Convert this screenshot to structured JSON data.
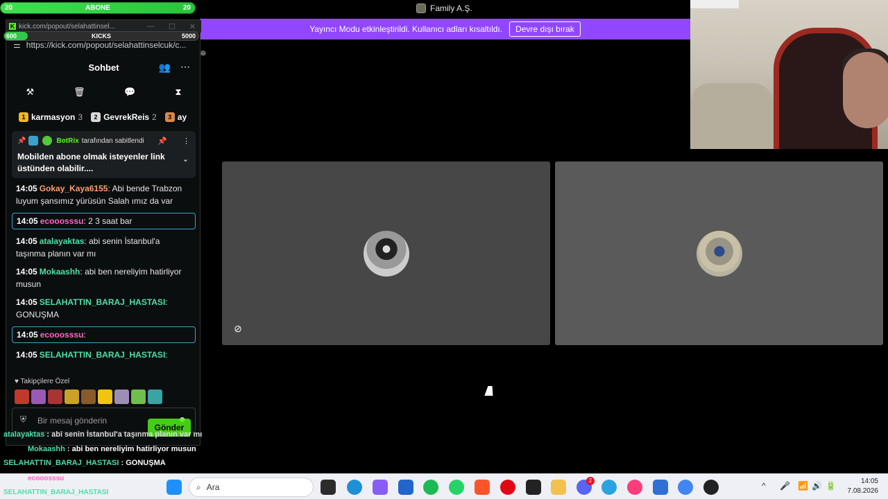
{
  "overlay": {
    "goal": {
      "left": "20",
      "label": "ABONE",
      "right": "20"
    },
    "kicks": {
      "current": "600",
      "label": "KICKS",
      "goal": "5000",
      "progress": 0.12
    }
  },
  "meeting": {
    "title": "Family A.Ş.",
    "banner_text": "Yayıncı Modu etkinleştirildi. Kullanıcı adları kısaltıldı.",
    "banner_button": "Devre dışı bırak"
  },
  "chat_window": {
    "tab_url": "kick.com/popout/selahattinsel...",
    "address": "https://kick.com/popout/selahattinselcuk/c...",
    "header_title": "Sohbet",
    "leaderboard": [
      {
        "rank": "1",
        "name": "karmasyon",
        "count": "3",
        "color": "#f0b429"
      },
      {
        "rank": "2",
        "name": "GevrekReis",
        "count": "2",
        "color": "#d9d9d9"
      },
      {
        "rank": "3",
        "name": "ay",
        "count": "",
        "color": "#d7894a"
      }
    ],
    "pinned": {
      "author": "BotRix",
      "pinned_by": "tarafından sabitlendi",
      "message": "Mobilden abone olmak isteyenler link üstünden olabilir...."
    },
    "messages": [
      {
        "time": "14:05",
        "user": "Gokay_Kaya6155",
        "user_color": "#ff9d6b",
        "text": " Abi bende Trabzon luyum şansımız yürüsün Salah ımız da var",
        "highlight": false
      },
      {
        "time": "14:05",
        "user": "ecooosssu",
        "user_color": "#ff66c4",
        "text": " 2 3 saat bar",
        "highlight": true
      },
      {
        "time": "14:05",
        "user": "atalayaktas",
        "user_color": "#4de0a8",
        "text": " abi senin İstanbul'a taşınma planın var mı",
        "highlight": false
      },
      {
        "time": "14:05",
        "user": "Mokaashh",
        "user_color": "#4de0a8",
        "text": " abi ben nereliyim hatirliyor musun",
        "highlight": false
      },
      {
        "time": "14:05",
        "user": "SELAHATTIN_BARAJ_HASTASI",
        "user_color": "#4de0a8",
        "text": " GONUŞMA",
        "highlight": false
      },
      {
        "time": "14:05",
        "user": "ecooosssu",
        "user_color": "#ff66c4",
        "text": "",
        "highlight": true
      },
      {
        "time": "14:05",
        "user": "SELAHATTIN_BARAJ_HASTASI",
        "user_color": "#4de0a8",
        "text": "",
        "highlight": false
      }
    ],
    "emote_section": "Takipçilere Özel",
    "input_placeholder": "Bir mesaj gönderin",
    "send_label": "Gönder"
  },
  "overlay_chat": [
    {
      "user": "atalayaktas",
      "text": "abi senin İstanbul'a taşınma planın var mı"
    },
    {
      "user": "Mokaashh",
      "text": "abi ben nereliyim hatirliyor musun"
    },
    {
      "user": "SELAHATTIN_BARAJ_HASTASI",
      "text": "GONUŞMA"
    },
    {
      "user": "ecooosssu",
      "text": ""
    },
    {
      "user": "SELAHATTIN_BARAJ_HASTASI",
      "text": ""
    }
  ],
  "taskbar": {
    "search_placeholder": "Ara",
    "time": "14:05",
    "date": "7.08.2026",
    "discord_badge": "2"
  }
}
